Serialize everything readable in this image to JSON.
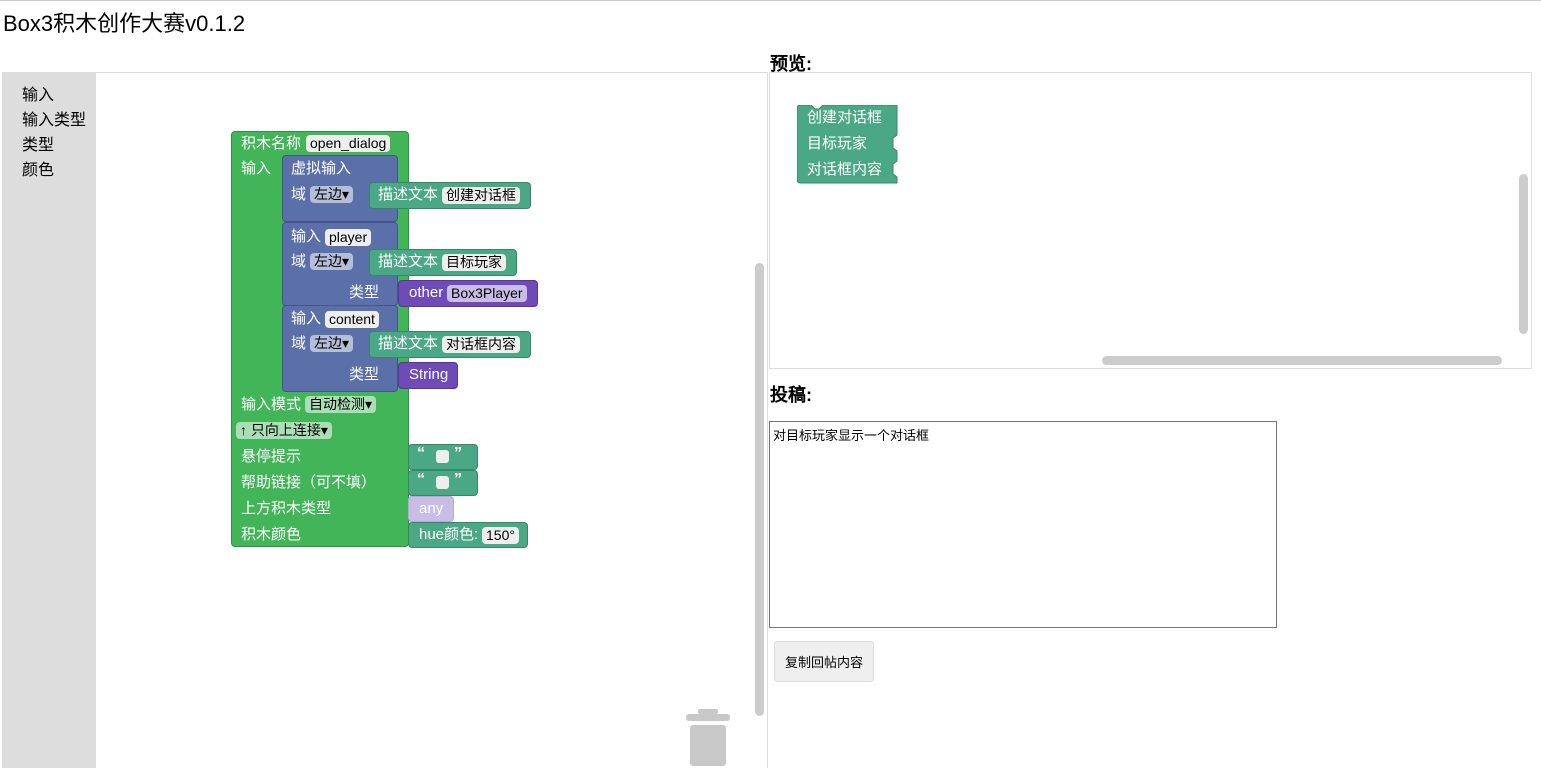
{
  "app": {
    "title": "Box3积木创作大赛v0.1.2"
  },
  "toolbox": {
    "items": [
      "输入",
      "输入类型",
      "类型",
      "颜色"
    ]
  },
  "block": {
    "name_label": "积木名称",
    "name_value": "open_dialog",
    "input_label": "输入",
    "inputs": [
      {
        "kind_label": "虚拟输入",
        "name": "",
        "field_label": "域",
        "align": "左边",
        "desc_label": "描述文本",
        "desc": "创建对话框",
        "type_label": "",
        "type_kind": "",
        "type_value": ""
      },
      {
        "kind_label": "输入",
        "name": "player",
        "field_label": "域",
        "align": "左边",
        "desc_label": "描述文本",
        "desc": "目标玩家",
        "type_label": "类型",
        "type_kind": "other",
        "type_value": "Box3Player"
      },
      {
        "kind_label": "输入",
        "name": "content",
        "field_label": "域",
        "align": "左边",
        "desc_label": "描述文本",
        "desc": "对话框内容",
        "type_label": "类型",
        "type_kind": "",
        "type_value": "String"
      }
    ],
    "input_mode_label": "输入模式",
    "input_mode_value": "自动检测",
    "connection_value": "↑ 只向上连接",
    "tooltip_label": "悬停提示",
    "help_label": "帮助链接（可不填）",
    "top_type_label": "上方积木类型",
    "top_type_value": "any",
    "color_label": "积木颜色",
    "hue_label": "hue颜色:",
    "hue_value": "150°",
    "quote_open": "“",
    "quote_close": "”",
    "dropdown_arrow": "▾"
  },
  "preview": {
    "label": "预览:",
    "lines": [
      "创建对话框",
      "目标玩家",
      "对话框内容"
    ]
  },
  "submission": {
    "label": "投稿:",
    "text": "对目标玩家显示一个对话框",
    "copy_button": "复制回帖内容"
  }
}
